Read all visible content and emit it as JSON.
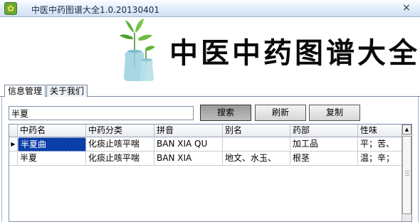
{
  "window": {
    "title": "中医中药图谱大全1.0.20130401",
    "close_glyph": "×",
    "app_icon_glyph": "✿"
  },
  "banner": {
    "title": "中医中药图谱大全"
  },
  "tabs": [
    {
      "label": "信息管理",
      "active": true
    },
    {
      "label": "关于我们",
      "active": false
    }
  ],
  "search": {
    "value": "半夏",
    "search_label": "搜索",
    "refresh_label": "刷新",
    "copy_label": "复制"
  },
  "grid": {
    "columns": [
      "中药名",
      "中药分类",
      "拼音",
      "别名",
      "药部",
      "性味"
    ],
    "rows": [
      [
        "半夏曲",
        "化痰止咳平喘",
        "BAN XIA QU",
        "",
        "加工品",
        "平；苦、"
      ],
      [
        "半夏",
        "化痰止咳平喘",
        "BAN XIA",
        "地文、水玉、",
        "根茎",
        "温；辛；"
      ]
    ],
    "current_row_marker": "▶",
    "scroll_up_glyph": "▲"
  },
  "colors": {
    "selection": "#0a3fa8",
    "titlebar": "#dbe8f7"
  }
}
